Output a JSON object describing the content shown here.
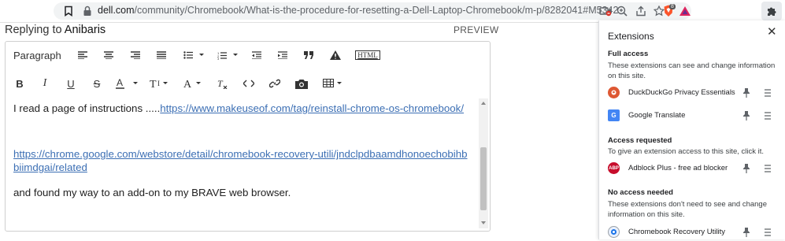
{
  "browser": {
    "url_domain": "dell.com",
    "url_path": "/community/Chromebook/What-is-the-procedure-for-resetting-a-Dell-Laptop-Chromebook/m-p/8282041#M5342",
    "brave_badge": "8"
  },
  "editor": {
    "heading_prefix": "Replying to",
    "heading_user": "Anibaris",
    "preview_label": "PREVIEW",
    "toolbar": {
      "paragraph": "Paragraph",
      "html": "HTML"
    },
    "content": {
      "p1_text": "I read a page of instructions .....",
      "p1_link": "https://www.makeuseof.com/tag/reinstall-chrome-os-chromebook/",
      "p2_link": "https://chrome.google.com/webstore/detail/chromebook-recovery-utili/jndclpdbaamdhonoechobihbbiimdgai/related",
      "p3_text": "and found my way to an add-on to my BRAVE web browser."
    }
  },
  "extensions": {
    "title": "Extensions",
    "full_access": {
      "title": "Full access",
      "desc": "These extensions can see and change information on this site.",
      "items": [
        {
          "name": "DuckDuckGo Privacy Essentials",
          "icon": "duckduckgo-icon",
          "color": "#de5833"
        },
        {
          "name": "Google Translate",
          "icon": "google-translate-icon",
          "color": "#4285f4"
        }
      ]
    },
    "access_requested": {
      "title": "Access requested",
      "desc": "To give an extension access to this site, click it.",
      "items": [
        {
          "name": "Adblock Plus - free ad blocker",
          "icon": "adblock-plus-icon",
          "color": "#c70d2c",
          "logo_text": "ABP"
        }
      ]
    },
    "no_access": {
      "title": "No access needed",
      "desc": "These extensions don't need to see and change information on this site.",
      "items": [
        {
          "name": "Chromebook Recovery Utility",
          "icon": "chromebook-recovery-icon",
          "color": "#1a73e8"
        }
      ]
    }
  }
}
